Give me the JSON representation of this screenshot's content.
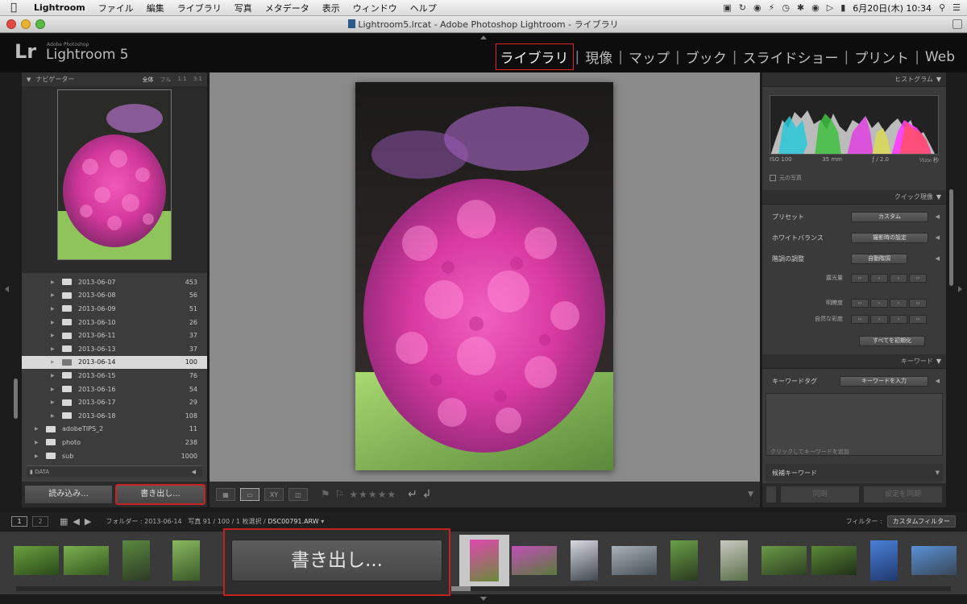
{
  "menubar": {
    "app": "Lightroom",
    "items": [
      "ファイル",
      "編集",
      "ライブラリ",
      "写真",
      "メタデータ",
      "表示",
      "ウィンドウ",
      "ヘルプ"
    ],
    "clock": "6月20日(木)  10:34"
  },
  "window": {
    "title": "Lightroom5.lrcat - Adobe Photoshop Lightroom - ライブラリ"
  },
  "identity": {
    "logo": "Lr",
    "brand_small": "Adobe Photoshop",
    "brand": "Lightroom 5"
  },
  "modules": {
    "library": "ライブラリ",
    "develop": "現像",
    "map": "マップ",
    "book": "ブック",
    "slideshow": "スライドショー",
    "print": "プリント",
    "web": "Web",
    "separator": "|"
  },
  "navigator": {
    "title": "ナビゲーター",
    "zoom_options": [
      "全体",
      "フル",
      "1:1",
      "3:1"
    ]
  },
  "folders": [
    {
      "name": "2013-06-07",
      "count": "453",
      "level": 2,
      "selected": false
    },
    {
      "name": "2013-06-08",
      "count": "56",
      "level": 2,
      "selected": false
    },
    {
      "name": "2013-06-09",
      "count": "51",
      "level": 2,
      "selected": false
    },
    {
      "name": "2013-06-10",
      "count": "26",
      "level": 2,
      "selected": false
    },
    {
      "name": "2013-06-11",
      "count": "37",
      "level": 2,
      "selected": false
    },
    {
      "name": "2013-06-13",
      "count": "37",
      "level": 2,
      "selected": false
    },
    {
      "name": "2013-06-14",
      "count": "100",
      "level": 2,
      "selected": true
    },
    {
      "name": "2013-06-15",
      "count": "76",
      "level": 2,
      "selected": false
    },
    {
      "name": "2013-06-16",
      "count": "54",
      "level": 2,
      "selected": false
    },
    {
      "name": "2013-06-17",
      "count": "29",
      "level": 2,
      "selected": false
    },
    {
      "name": "2013-06-18",
      "count": "108",
      "level": 2,
      "selected": false
    },
    {
      "name": "adobeTIPS_2",
      "count": "11",
      "level": 1,
      "selected": false
    },
    {
      "name": "photo",
      "count": "238",
      "level": 1,
      "selected": false
    },
    {
      "name": "sub",
      "count": "1000",
      "level": 1,
      "selected": false
    }
  ],
  "data_panel": "DATA",
  "left_buttons": {
    "import": "読み込み...",
    "export": "書き出し..."
  },
  "histogram": {
    "title": "ヒストグラム",
    "iso": "ISO 100",
    "focal": "35 mm",
    "aperture": "ƒ / 2.0",
    "shutter": "¹⁄₁₂₅₀ 秒",
    "original_photo": "元の写真"
  },
  "quick_develop": {
    "title": "クイック現像",
    "preset_label": "プリセット",
    "preset_value": "カスタム",
    "wb_label": "ホワイトバランス",
    "wb_value": "撮影時の設定",
    "tone_label": "階調の調整",
    "tone_value": "自動階調",
    "exposure_label": "露光量",
    "clarity_label": "明瞭度",
    "vibrance_label": "自然な彩度",
    "reset_all": "すべてを初期化"
  },
  "keyword": {
    "title": "キーワード",
    "tag_label": "キーワードタグ",
    "tag_value": "キーワードを入力",
    "hint": "クリックしてキーワードを追加",
    "suggest": "候補キーワード"
  },
  "right_buttons": {
    "sync": "同期",
    "sync_settings": "設定を同期"
  },
  "filmbar": {
    "monitor1": "1",
    "monitor2": "2",
    "folder_label": "フォルダー : 2013-06-14",
    "photo_count": "写真 91 / 100 / 1 枚選択 /",
    "filename": "DSC00791.ARW",
    "filter_label": "フィルター :",
    "filter_value": "カスタムフィルター"
  },
  "callout": {
    "label": "書き出し..."
  },
  "colors": {
    "highlight": "#c52020",
    "panel": "#3c3c3c",
    "center": "#8a8a8a"
  }
}
